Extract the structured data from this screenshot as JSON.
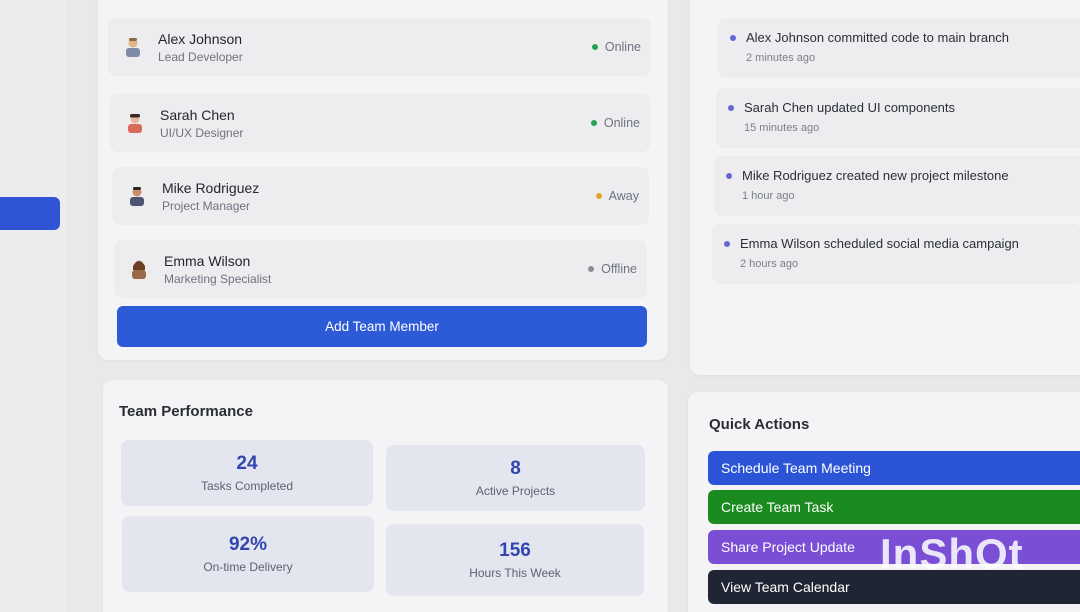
{
  "team_members": [
    {
      "name": "Alex Johnson",
      "role": "Lead Developer",
      "status": "Online",
      "status_color": "#27a055",
      "avatar_icon": "developer-avatar-icon"
    },
    {
      "name": "Sarah Chen",
      "role": "UI/UX Designer",
      "status": "Online",
      "status_color": "#27a055",
      "avatar_icon": "designer-avatar-icon"
    },
    {
      "name": "Mike Rodriguez",
      "role": "Project Manager",
      "status": "Away",
      "status_color": "#e2a52c",
      "avatar_icon": "manager-avatar-icon"
    },
    {
      "name": "Emma Wilson",
      "role": "Marketing Specialist",
      "status": "Offline",
      "status_color": "#8a8d95",
      "avatar_icon": "marketer-avatar-icon"
    }
  ],
  "add_member_label": "Add Team Member",
  "activities": [
    {
      "text": "Alex Johnson committed code to main branch",
      "time": "2 minutes ago"
    },
    {
      "text": "Sarah Chen updated UI components",
      "time": "15 minutes ago"
    },
    {
      "text": "Mike Rodriguez created new project milestone",
      "time": "1 hour ago"
    },
    {
      "text": "Emma Wilson scheduled social media campaign",
      "time": "2 hours ago"
    }
  ],
  "performance": {
    "title": "Team Performance",
    "stats": [
      {
        "value": "24",
        "label": "Tasks Completed"
      },
      {
        "value": "8",
        "label": "Active Projects"
      },
      {
        "value": "92%",
        "label": "On-time Delivery"
      },
      {
        "value": "156",
        "label": "Hours This Week"
      }
    ]
  },
  "quick_actions": {
    "title": "Quick Actions",
    "buttons": [
      {
        "label": "Schedule Team Meeting",
        "color": "#2b55d6"
      },
      {
        "label": "Create Team Task",
        "color": "#1b8a1f"
      },
      {
        "label": "Share Project Update",
        "color": "#7a4fd6"
      },
      {
        "label": "View Team Calendar",
        "color": "#1f2533"
      }
    ]
  },
  "watermark": "InShOt",
  "colors": {
    "accent": "#2d5bd8",
    "panel": "#f4f4f6"
  }
}
